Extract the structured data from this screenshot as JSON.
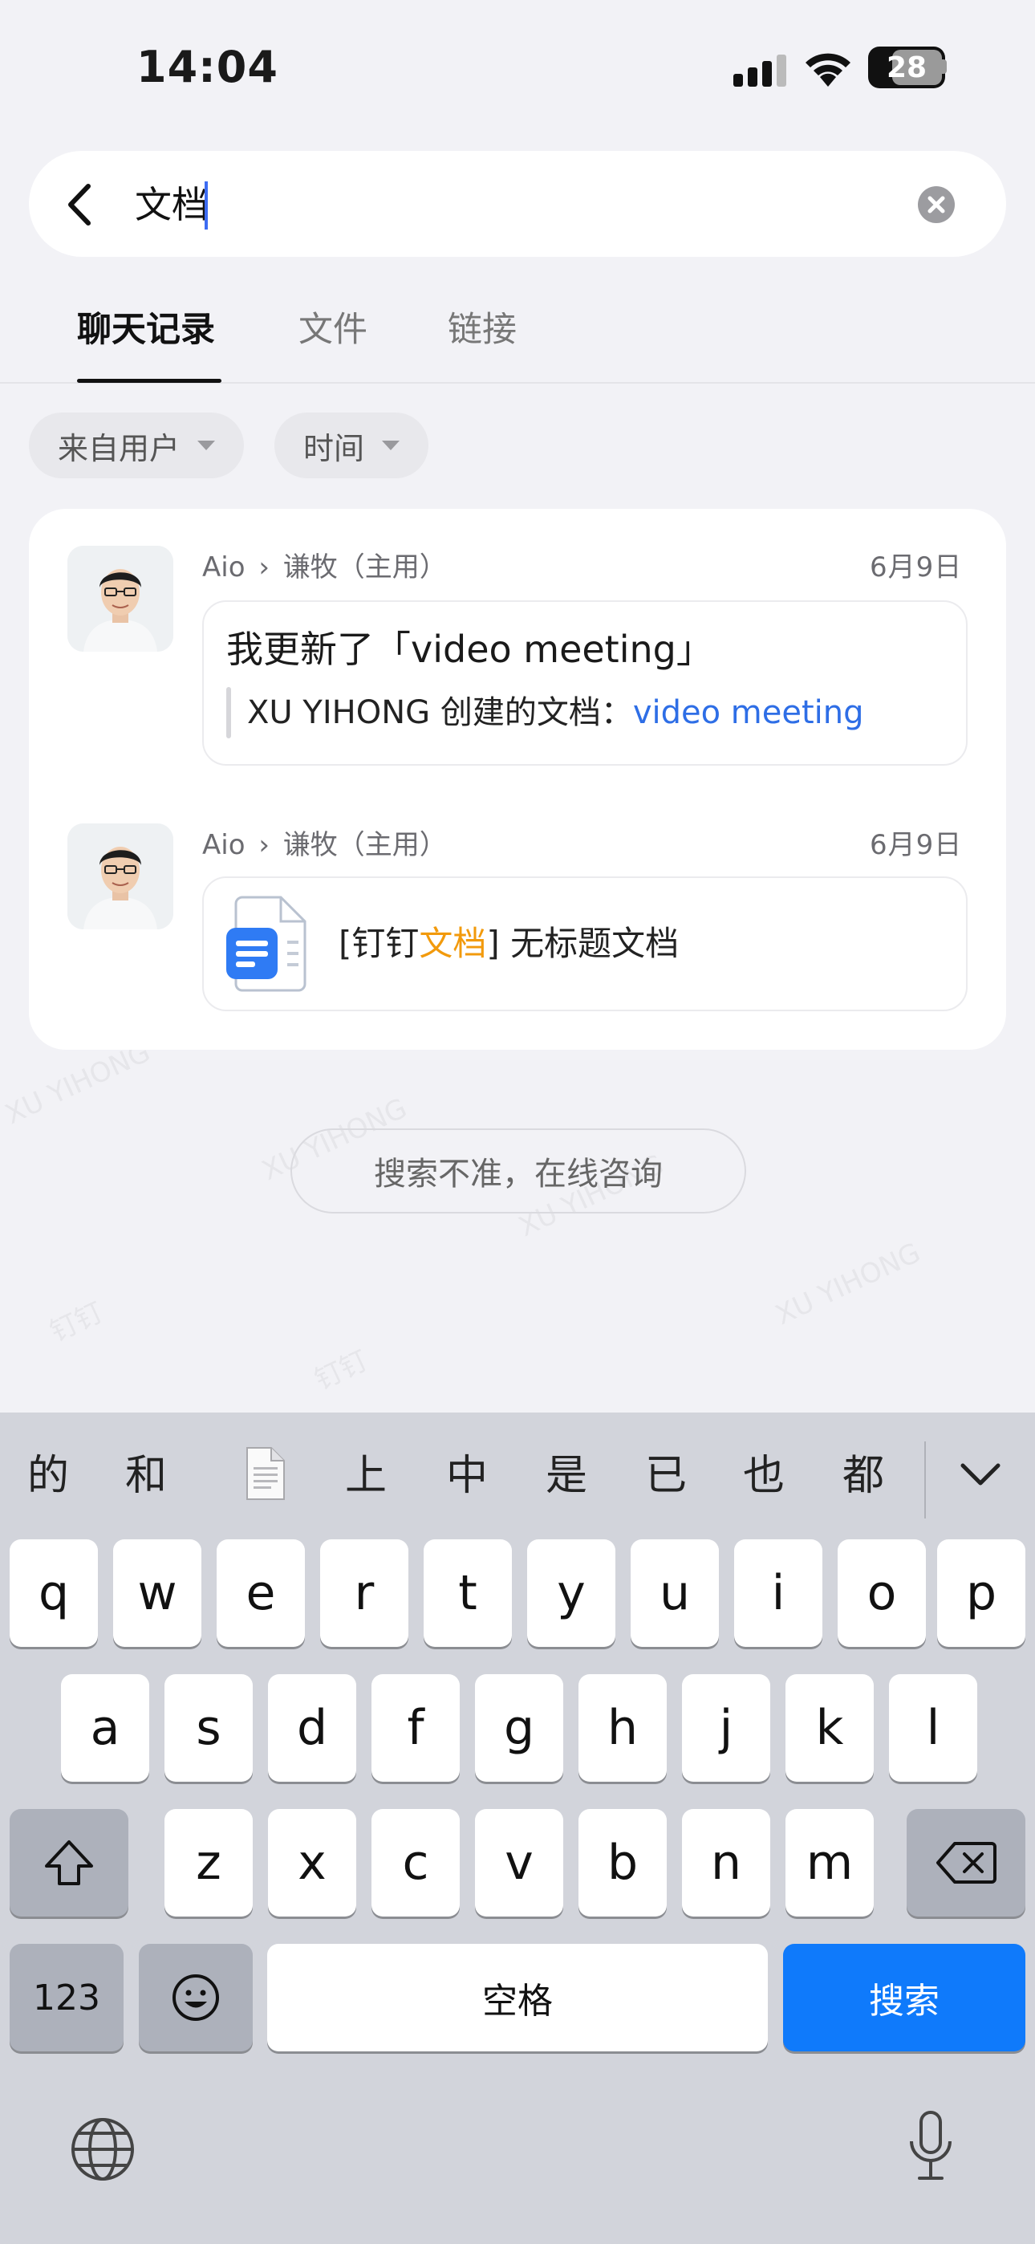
{
  "status_bar": {
    "time": "14:04",
    "battery": "28"
  },
  "search": {
    "query": "文档"
  },
  "tabs": [
    {
      "label": "聊天记录"
    },
    {
      "label": "文件"
    },
    {
      "label": "链接"
    }
  ],
  "filters": [
    {
      "label": "来自用户"
    },
    {
      "label": "时间"
    }
  ],
  "results": [
    {
      "path_group": "Aio",
      "path_user": "谦牧（主用）",
      "date": "6月9日",
      "title": "我更新了「video meeting」",
      "quote_prefix": "XU YIHONG 创建的文档：",
      "quote_link": "video meeting"
    },
    {
      "path_group": "Aio",
      "path_user": "谦牧（主用）",
      "date": "6月9日",
      "file_prefix": "[钉钉",
      "file_highlight": "文档",
      "file_suffix": "] 无标题文档"
    }
  ],
  "feedback_label": "搜索不准，在线咨询",
  "watermarks": [
    "XU YIHONG",
    "钉钉"
  ],
  "keyboard": {
    "candidates": [
      "的",
      "和",
      "上",
      "中",
      "是",
      "已",
      "也",
      "都"
    ],
    "row1": [
      "q",
      "w",
      "e",
      "r",
      "t",
      "y",
      "u",
      "i",
      "o",
      "p"
    ],
    "row2": [
      "a",
      "s",
      "d",
      "f",
      "g",
      "h",
      "j",
      "k",
      "l"
    ],
    "row3": [
      "z",
      "x",
      "c",
      "v",
      "b",
      "n",
      "m"
    ],
    "numbers_key": "123",
    "space_key": "空格",
    "search_key": "搜索"
  },
  "colors": {
    "accent_blue": "#0f7afb",
    "link_blue": "#2e6ee6",
    "highlight_orange": "#f29a0c"
  }
}
